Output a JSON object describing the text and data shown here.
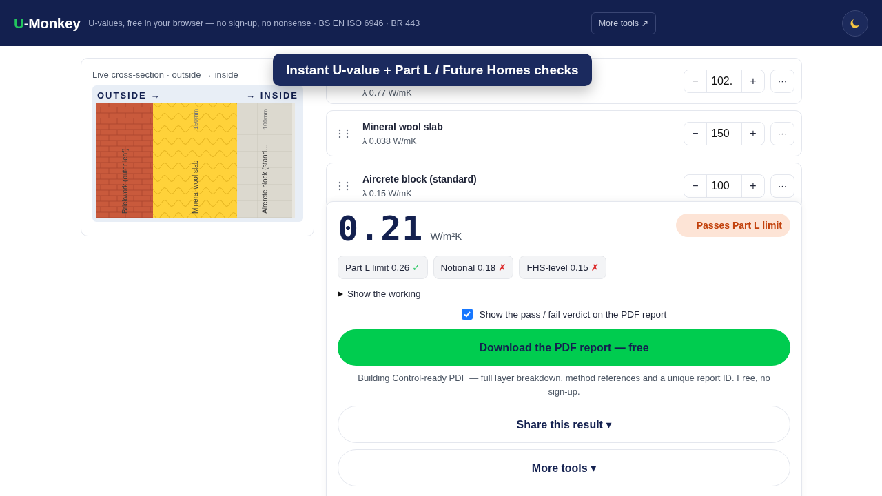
{
  "header": {
    "logo_accent": "U",
    "logo_rest": "-Monkey",
    "tagline": "U-values, free in your browser — no sign-up, no nonsense · BS EN ISO 6946 · BR 443",
    "more_tools": "More tools ↗"
  },
  "banner": "Instant U-value + Part L / Future Homes checks",
  "cross_section": {
    "caption": "Live cross-section · outside → inside",
    "outside": "OUTSIDE →",
    "inside": "→ INSIDE",
    "layers": [
      {
        "kind": "brick",
        "label": "Brickwork (outer leaf)"
      },
      {
        "kind": "wool",
        "label": "Mineral wool slab",
        "thickness": "150mm"
      },
      {
        "kind": "block",
        "label": "Aircrete block (stand...",
        "thickness": "100mm"
      }
    ]
  },
  "layers": [
    {
      "lambda": "λ 0.77 W/mK",
      "value": "102.",
      "minus": "−",
      "plus": "+",
      "more": "···"
    },
    {
      "name": "Mineral wool slab",
      "lambda": "λ 0.038 W/mK",
      "value": "150",
      "minus": "−",
      "plus": "+",
      "more": "···"
    },
    {
      "name": "Aircrete block (standard)",
      "lambda": "λ 0.15 W/mK",
      "value": "100",
      "minus": "−",
      "plus": "+",
      "more": "···"
    }
  ],
  "result": {
    "value": "0.21",
    "unit": "W/m²K",
    "verdict": "Passes Part L limit",
    "checks": [
      {
        "label": "Part L limit 0.26",
        "mark": "✓",
        "pass": true
      },
      {
        "label": "Notional 0.18",
        "mark": "✗",
        "pass": false
      },
      {
        "label": "FHS-level 0.15",
        "mark": "✗",
        "pass": false
      }
    ],
    "working": {
      "label": "Show the working",
      "expanded": false
    },
    "verdict_option": {
      "label": "Show the pass / fail verdict on the PDF report",
      "checked": true
    },
    "download": "Download the PDF report — free",
    "download_note": "Building Control-ready PDF — full layer breakdown, method references and a unique report ID. Free, no sign-up.",
    "share": "Share this result ▾",
    "more_tools": "More tools ▾"
  }
}
